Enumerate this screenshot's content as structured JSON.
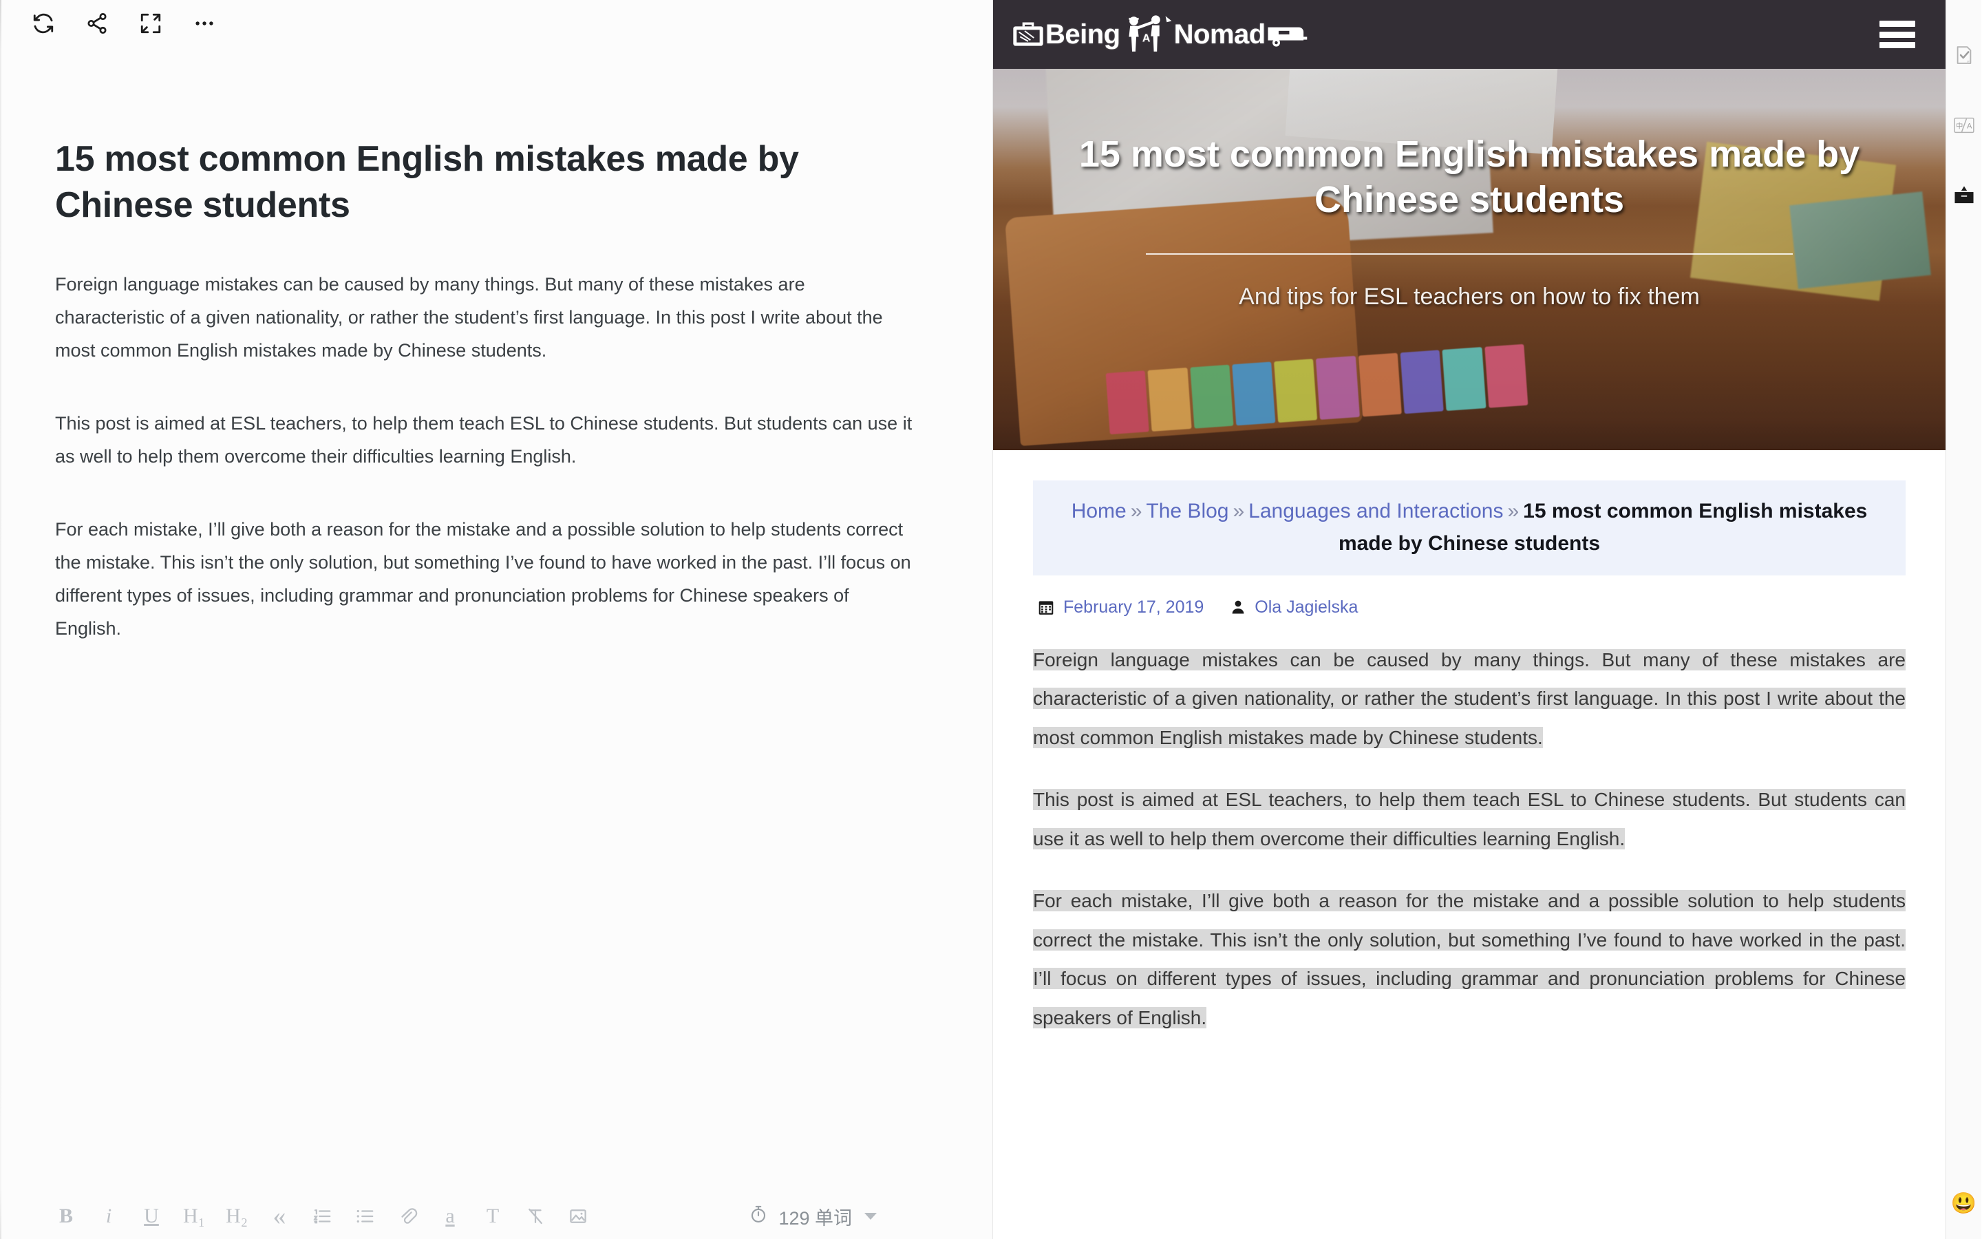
{
  "editor": {
    "toolbar_top": [
      {
        "name": "sync-icon",
        "label": "Sync"
      },
      {
        "name": "share-icon",
        "label": "Share"
      },
      {
        "name": "fullscreen-icon",
        "label": "Fullscreen"
      },
      {
        "name": "more-icon",
        "label": "More"
      }
    ],
    "title": "15 most common English mistakes made by Chinese students",
    "paragraphs": [
      "Foreign language mistakes can be caused by many things. But many of these mistakes are characteristic of a given nationality, or rather the student’s first language. In this post I write about the most common English mistakes made by Chinese students.",
      "This post is aimed at ESL teachers, to help them teach ESL to Chinese students. But students can use it as well to help them overcome their difficulties learning English.",
      "For each mistake, I’ll give both a reason for the mistake and a possible solution to help students correct the mistake. This isn’t the only solution, but something I’ve found to have worked in the past. I’ll focus on different types of issues, including grammar and pronunciation problems for Chinese speakers of English."
    ],
    "format_toolbar": [
      {
        "name": "bold-button",
        "label": "B"
      },
      {
        "name": "italic-button",
        "label": "i"
      },
      {
        "name": "underline-button",
        "label": "U"
      },
      {
        "name": "heading-1-button",
        "label": "H₁"
      },
      {
        "name": "heading-2-button",
        "label": "H₂"
      },
      {
        "name": "blockquote-button",
        "label": "«"
      },
      {
        "name": "ordered-list-button",
        "label": "ordered-list-icon"
      },
      {
        "name": "unordered-list-button",
        "label": "unordered-list-icon"
      },
      {
        "name": "link-button",
        "label": "link-icon"
      },
      {
        "name": "highlight-button",
        "label": "a"
      },
      {
        "name": "text-style-button",
        "label": "T"
      },
      {
        "name": "clear-format-button",
        "label": "clear-format-icon"
      },
      {
        "name": "insert-image-button",
        "label": "image-icon"
      }
    ],
    "word_count": "129 单词",
    "timer_icon": "stopwatch-icon"
  },
  "preview": {
    "site_logo": {
      "word1": "Being",
      "word2": "A",
      "word3": "Nomad",
      "suitcase_icon": "suitcase-icon",
      "people_icon": "two-people-icon",
      "caravan_icon": "caravan-icon"
    },
    "menu_icon": "hamburger-menu-icon",
    "hero": {
      "title": "15 most common English mistakes made by Chinese students",
      "subtitle": "And tips for ESL teachers on how to fix them"
    },
    "breadcrumb": {
      "items": [
        "Home",
        "The Blog",
        "Languages and Interactions"
      ],
      "separator": "»",
      "current": "15 most common English mistakes made by Chinese students"
    },
    "meta": {
      "calendar_icon": "calendar-icon",
      "date": "February 17, 2019",
      "author_icon": "user-icon",
      "author": "Ola Jagielska"
    },
    "paragraphs": [
      "Foreign language mistakes can be caused by many things. But many of these mistakes are characteristic of a given nationality, or rather the student’s first language. In this post I write about the most common English mistakes made by Chinese students.",
      "This post is aimed at ESL teachers, to help them teach ESL to Chinese students. But students can use it as well to help them overcome their difficulties learning English.",
      "For each mistake, I’ll give both a reason for the mistake and a possible solution to help students correct the mistake. This isn’t the only solution, but something I’ve found to have worked in the past. I’ll focus on different types of issues, including grammar and pronunciation problems for Chinese speakers of English."
    ]
  },
  "rail": {
    "items": [
      {
        "name": "document-check-icon",
        "label": "Proofread"
      },
      {
        "name": "translate-icon",
        "label": "中/A"
      },
      {
        "name": "inbox-icon",
        "label": "Inbox"
      }
    ],
    "emoji": "😃"
  },
  "colors": {
    "header_bg": "#332e35",
    "breadcrumb_bg": "#eef2fb",
    "link": "#5c6bc0",
    "selection_highlight": "#d9d9d9",
    "editor_bg": "#fcfcfc",
    "rail_bg": "#fafafa"
  }
}
